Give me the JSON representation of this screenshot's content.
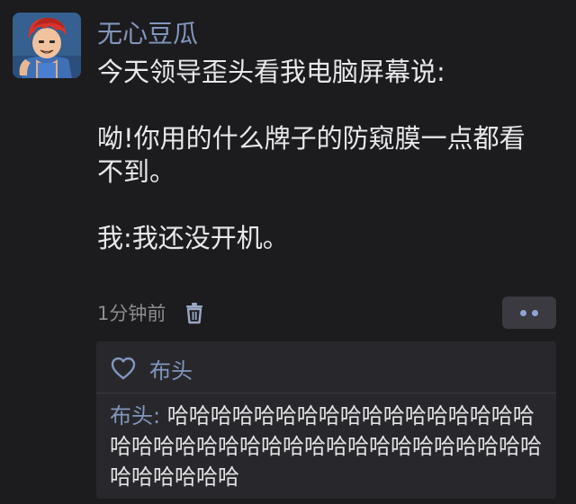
{
  "post": {
    "username": "无心豆瓜",
    "content": {
      "line1": "今天领导歪头看我电脑屏幕说:",
      "line2": "呦!你用的什么牌子的防窥膜一点都看不到。",
      "line3": "我:我还没开机。"
    },
    "time": "1分钟前",
    "avatar_icon": "cartoon-avatar-icon",
    "delete_icon": "trash-icon",
    "more_icon": "more-dots-icon"
  },
  "likes": {
    "icon": "heart-outline-icon",
    "names": "布头"
  },
  "comments": [
    {
      "author": "布头",
      "separator": ": ",
      "text": "哈哈哈哈哈哈哈哈哈哈哈哈哈哈哈哈哈哈哈哈哈哈哈哈哈哈哈哈哈哈哈哈哈哈哈哈哈哈哈哈哈哈哈"
    }
  ],
  "colors": {
    "background": "#1c1c1e",
    "name_blue": "#8296be",
    "text": "#e8e8ea",
    "muted": "#8c8c92",
    "panel": "#28282c"
  }
}
